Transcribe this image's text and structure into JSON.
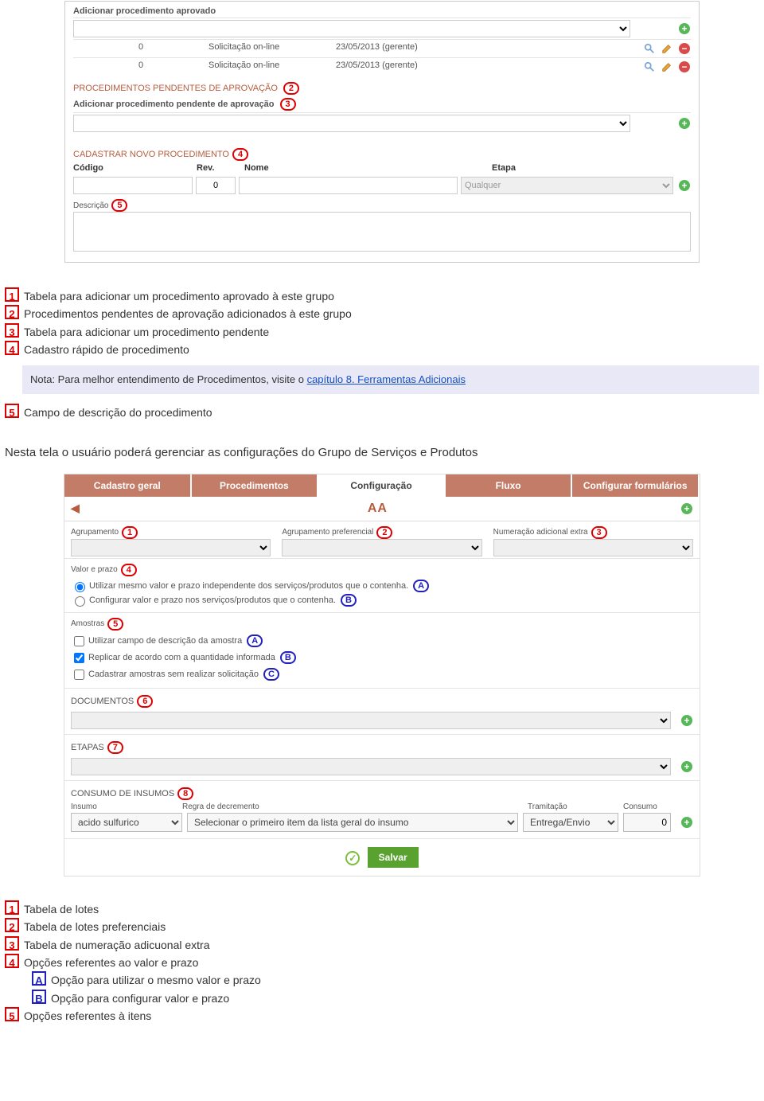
{
  "panel1": {
    "add_aprovado_label": "Adicionar procedimento aprovado",
    "rows": [
      {
        "qty": "0",
        "origem": "Solicitação on-line",
        "data": "23/05/2013 (gerente)"
      },
      {
        "qty": "0",
        "origem": "Solicitação on-line",
        "data": "23/05/2013 (gerente)"
      }
    ],
    "pending_title": "PROCEDIMENTOS PENDENTES DE APROVAÇÃO",
    "add_pendente_label": "Adicionar procedimento pendente de aprovação",
    "cadastrar_title": "CADASTRAR NOVO PROCEDIMENTO",
    "headers": {
      "codigo": "Código",
      "rev": "Rev.",
      "nome": "Nome",
      "etapa": "Etapa"
    },
    "rev_default": "0",
    "etapa_placeholder": "Qualquer",
    "descricao_label": "Descrição"
  },
  "legend1": {
    "l1": "Tabela para adicionar um procedimento aprovado à este grupo",
    "l2": "Procedimentos pendentes de aprovação adicionados à este grupo",
    "l3": "Tabela para adicionar um procedimento pendente",
    "l4": "Cadastro rápido de procedimento",
    "nota_prefix": "Nota: Para melhor entendimento de Procedimentos, visite o  ",
    "nota_link": "capítulo 8. Ferramentas Adicionais",
    "l5": "Campo de descrição do procedimento"
  },
  "intro2": "Nesta tela o usuário poderá gerenciar as configurações do Grupo de Serviços e Produtos",
  "tabs": {
    "t1": "Cadastro geral",
    "t2": "Procedimentos",
    "t3": "Configuração",
    "t4": "Fluxo",
    "t5": "Configurar formulários"
  },
  "aa_title": "AA",
  "cfg_labels": {
    "agrupamento": "Agrupamento",
    "agrup_pref": "Agrupamento preferencial",
    "num_extra": "Numeração adicional extra"
  },
  "valor": {
    "label": "Valor e prazo",
    "optA": "Utilizar mesmo valor e prazo independente dos serviços/produtos que o contenha.",
    "optB": "Configurar valor e prazo nos serviços/produtos que o contenha."
  },
  "amostras": {
    "label": "Amostras",
    "a": "Utilizar campo de descrição da amostra",
    "b": "Replicar de acordo com a quantidade informada",
    "c": "Cadastrar amostras sem realizar solicitação"
  },
  "documentos_label": "DOCUMENTOS",
  "etapas_label": "ETAPAS",
  "consumo": {
    "title": "CONSUMO DE INSUMOS",
    "h_insumo": "Insumo",
    "h_regra": "Regra de decremento",
    "h_tram": "Tramitação",
    "h_cons": "Consumo",
    "v_insumo": "acido sulfurico",
    "v_regra": "Selecionar o primeiro item da lista geral do insumo",
    "v_tram": "Entrega/Envio",
    "v_cons": "0"
  },
  "save_label": "Salvar",
  "legend2": {
    "l1": "Tabela de lotes",
    "l2": "Tabela de lotes preferenciais",
    "l3": "Tabela de numeração adicuonal extra",
    "l4": "Opções referentes ao valor e prazo",
    "lA": "Opção para utilizar o mesmo valor e prazo",
    "lB": "Opção para configurar valor e prazo",
    "l5": "Opções referentes à itens"
  }
}
